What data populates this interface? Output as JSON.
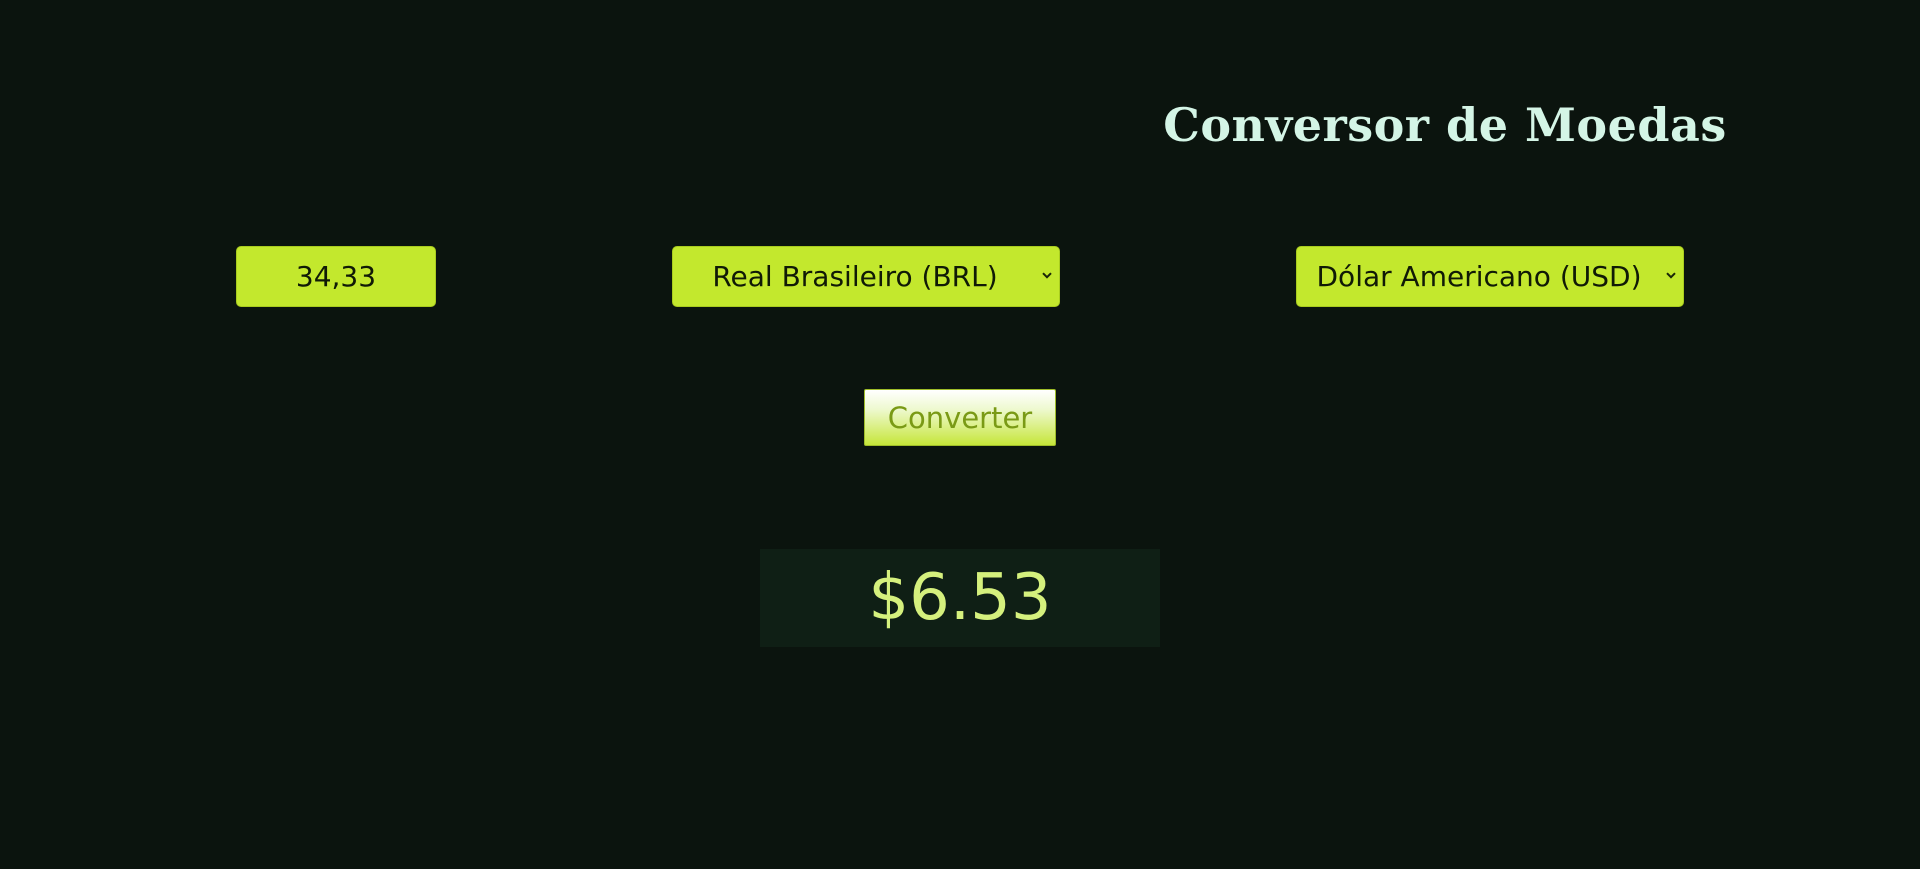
{
  "header": {
    "title": "Conversor de Moedas"
  },
  "form": {
    "amount_value": "34,33",
    "from_currency": {
      "selected": "Real Brasileiro (BRL)"
    },
    "to_currency": {
      "selected": "Dólar Americano (USD)"
    },
    "convert_label": "Converter"
  },
  "result": {
    "value": "$6.53"
  },
  "icons": {
    "select_caret": "chevron-down-icon"
  },
  "colors": {
    "background": "#0b140e",
    "accent": "#c3e82d",
    "title": "#d4f5e6",
    "result_text": "#d5f07d",
    "result_bg": "#0f1f15"
  }
}
